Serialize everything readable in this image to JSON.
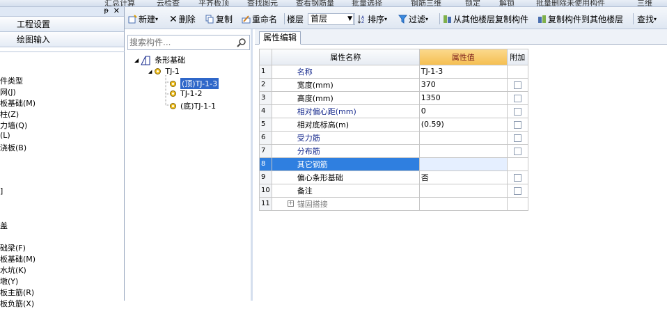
{
  "top_strip": [
    "汇总计算",
    "云检查",
    "平齐板顶",
    "查找图元",
    "查看钢筋量",
    "批量选择",
    "钢筋三维",
    "锁定",
    "解锁",
    "批量删除未使用构件",
    "三维"
  ],
  "left_panel": {
    "nav_buttons": [
      "工程设置",
      "绘图输入"
    ],
    "items": [
      "件类型",
      "网(J)",
      "板基础(M)",
      "柱(Z)",
      "力墙(Q)",
      "(L)",
      "浇板(B)",
      "]",
      "盖",
      "础梁(F)",
      "板基础(M)",
      "水坑(K)",
      "墩(Y)",
      "板主筋(R)",
      "板负筋(X)"
    ]
  },
  "toolbar": {
    "new": "新建",
    "delete": "删除",
    "copy": "复制",
    "rename": "重命名",
    "floor_label": "楼层",
    "floor_value": "首层",
    "sort": "排序",
    "filter": "过滤",
    "copy_from_floor": "从其他楼层复制构件",
    "copy_to_floor": "复制构件到其他楼层",
    "find": "查找"
  },
  "search": {
    "placeholder": "搜索构件..."
  },
  "tree": {
    "root": "条形基础",
    "group": "TJ-1",
    "children": [
      "(顶)TJ-1-3",
      "TJ-1-2",
      "(底)TJ-1-1"
    ]
  },
  "property_tab": "属性编辑",
  "grid": {
    "headers": [
      "属性名称",
      "属性值",
      "附加"
    ],
    "rows": [
      {
        "num": "1",
        "name": "名称",
        "value": "TJ-1-3"
      },
      {
        "num": "2",
        "name": "宽度(mm)",
        "value": "370"
      },
      {
        "num": "3",
        "name": "高度(mm)",
        "value": "1350"
      },
      {
        "num": "4",
        "name": "相对偏心距(mm)",
        "value": "0"
      },
      {
        "num": "5",
        "name": "相对底标高(m)",
        "value": "(0.59)"
      },
      {
        "num": "6",
        "name": "受力筋",
        "value": ""
      },
      {
        "num": "7",
        "name": "分布筋",
        "value": ""
      },
      {
        "num": "8",
        "name": "其它钢筋",
        "value": ""
      },
      {
        "num": "9",
        "name": "偏心条形基础",
        "value": "否"
      },
      {
        "num": "10",
        "name": "备注",
        "value": ""
      },
      {
        "num": "11",
        "name": "锚固搭接",
        "value": ""
      }
    ]
  },
  "colors": {
    "selection": "#2f67c9",
    "header_value": "#f5bf52",
    "link_text": "#1a2d8f"
  }
}
